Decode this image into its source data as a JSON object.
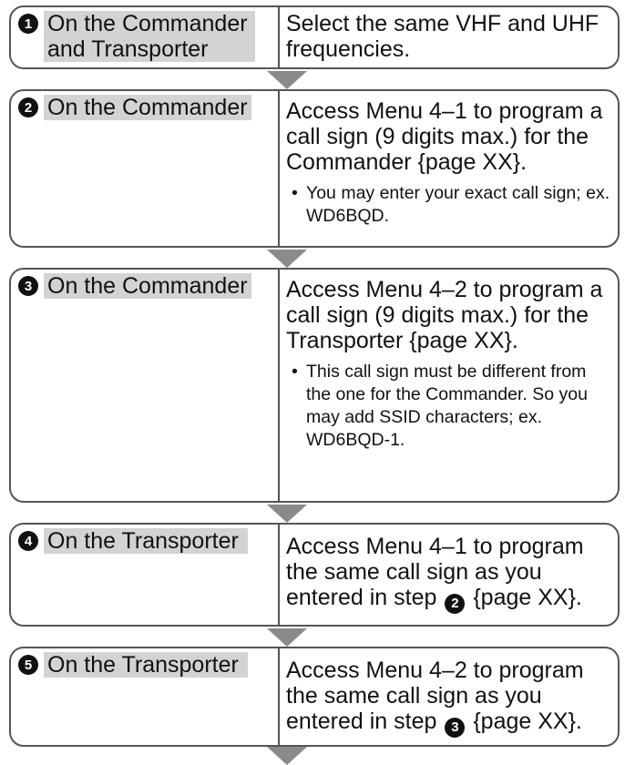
{
  "steps": [
    {
      "number": "1",
      "label": "On the Commander and Transporter",
      "instruction": "Select the same VHF and UHF frequencies.",
      "note": ""
    },
    {
      "number": "2",
      "label": "On the Commander",
      "instruction": "Access Menu 4–1 to program a call sign (9 digits max.) for the Commander {page XX}.",
      "note": "You may enter your exact call sign; ex. WD6BQD."
    },
    {
      "number": "3",
      "label": "On the Commander",
      "instruction": "Access Menu 4–2 to program a call sign (9 digits max.) for the Transporter {page XX}.",
      "note": "This call sign must be different from the one for the Commander.  So you may add SSID characters; ex. WD6BQD-1."
    },
    {
      "number": "4",
      "label": "On the Transporter",
      "instruction_before": "Access Menu 4–1 to program the same call sign as you entered in step",
      "step_ref": "2",
      "instruction_after": "{page XX}."
    },
    {
      "number": "5",
      "label": "On the Transporter",
      "instruction_before": "Access Menu 4–2 to program the same call sign as you entered in step",
      "step_ref": "3",
      "instruction_after": "{page XX}."
    }
  ]
}
